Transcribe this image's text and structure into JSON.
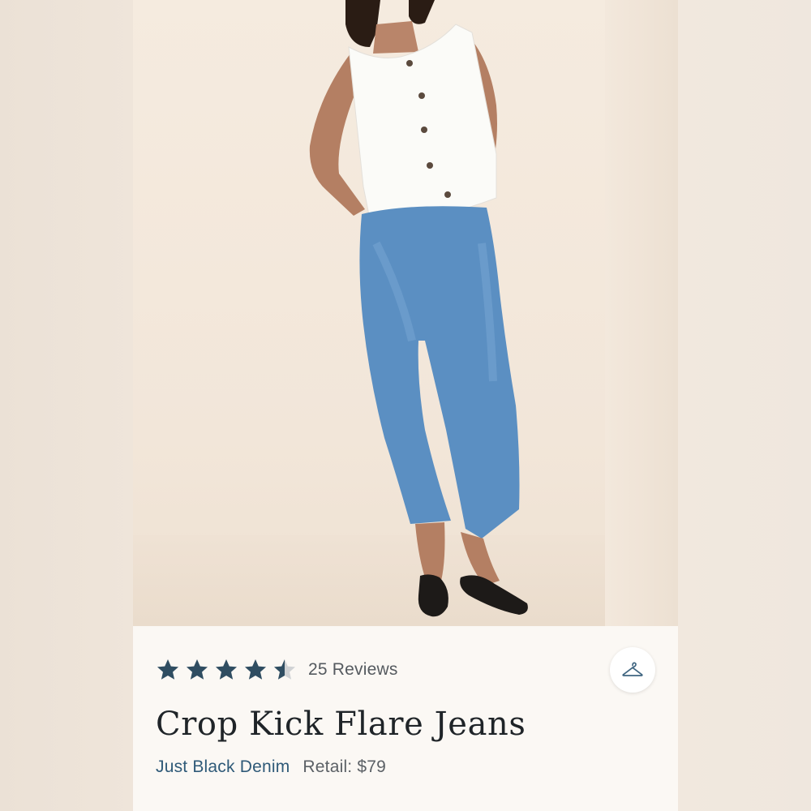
{
  "product": {
    "rating": 4.5,
    "rating_max": 5,
    "reviews_label": "25 Reviews",
    "title": "Crop Kick Flare Jeans",
    "brand": "Just Black Denim",
    "retail_label": "Retail: $79"
  },
  "icons": {
    "save": "hanger-icon",
    "rating": "star-icon"
  },
  "colors": {
    "star": "#2f4d61",
    "star_empty": "#d0d2d4",
    "brand": "#2f5a78",
    "title": "#1f2428"
  }
}
